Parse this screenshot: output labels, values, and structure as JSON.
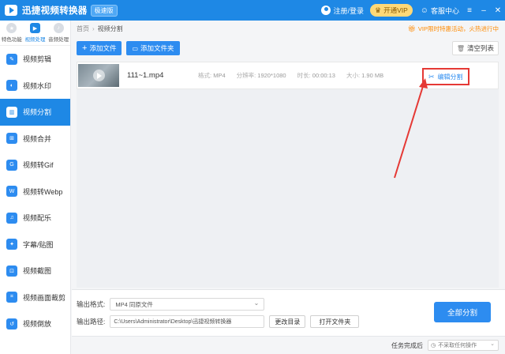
{
  "titlebar": {
    "app_name": "迅捷视频转换器",
    "badge": "极速版",
    "login": "注册/登录",
    "vip_button": "开通VIP",
    "customer_center": "客服中心",
    "minimize": "–",
    "close": "✕"
  },
  "sidebar": {
    "top_tabs": [
      {
        "label": "特色功能",
        "icon": "star-icon"
      },
      {
        "label": "视频处理",
        "icon": "video-icon"
      },
      {
        "label": "音频处理",
        "icon": "audio-icon"
      }
    ],
    "items": [
      {
        "label": "视频剪辑"
      },
      {
        "label": "视频水印"
      },
      {
        "label": "视频分割"
      },
      {
        "label": "视频合并"
      },
      {
        "label": "视频转Gif"
      },
      {
        "label": "视频转Webp"
      },
      {
        "label": "视频配乐"
      },
      {
        "label": "字幕/贴图"
      },
      {
        "label": "视频截图"
      },
      {
        "label": "视频画面裁剪"
      },
      {
        "label": "视频倒放"
      }
    ],
    "active_index": 2
  },
  "breadcrumb": {
    "home": "首页",
    "separator": "›",
    "current": "视频分割"
  },
  "promo": "VIP限时特惠活动，火热进行中",
  "toolbar": {
    "add_file": "添加文件",
    "add_folder": "添加文件夹",
    "clear_list": "清空列表"
  },
  "files": [
    {
      "name": "111~1.mp4",
      "format_label": "格式:",
      "format": "MP4",
      "resolution_label": "分辨率:",
      "resolution": "1920*1080",
      "duration_label": "时长:",
      "duration": "00:00:13",
      "size_label": "大小:",
      "size": "1.90 MB",
      "action": "编辑分割"
    }
  ],
  "output": {
    "format_label": "输出格式:",
    "format_value": "MP4  同原文件",
    "path_label": "输出路径:",
    "path_value": "C:\\Users\\Administrator\\Desktop\\迅捷视频转换器",
    "change_dir": "更改目录",
    "open_folder": "打开文件夹",
    "split_all": "全部分割"
  },
  "statusbar": {
    "label": "任务完成后",
    "option": "不采取任何操作"
  },
  "colors": {
    "primary": "#1e88e5",
    "button_blue": "#2d8cf0",
    "highlight_red": "#e53935",
    "promo_orange": "#ff8a00",
    "vip_gold": "#ffd978"
  }
}
